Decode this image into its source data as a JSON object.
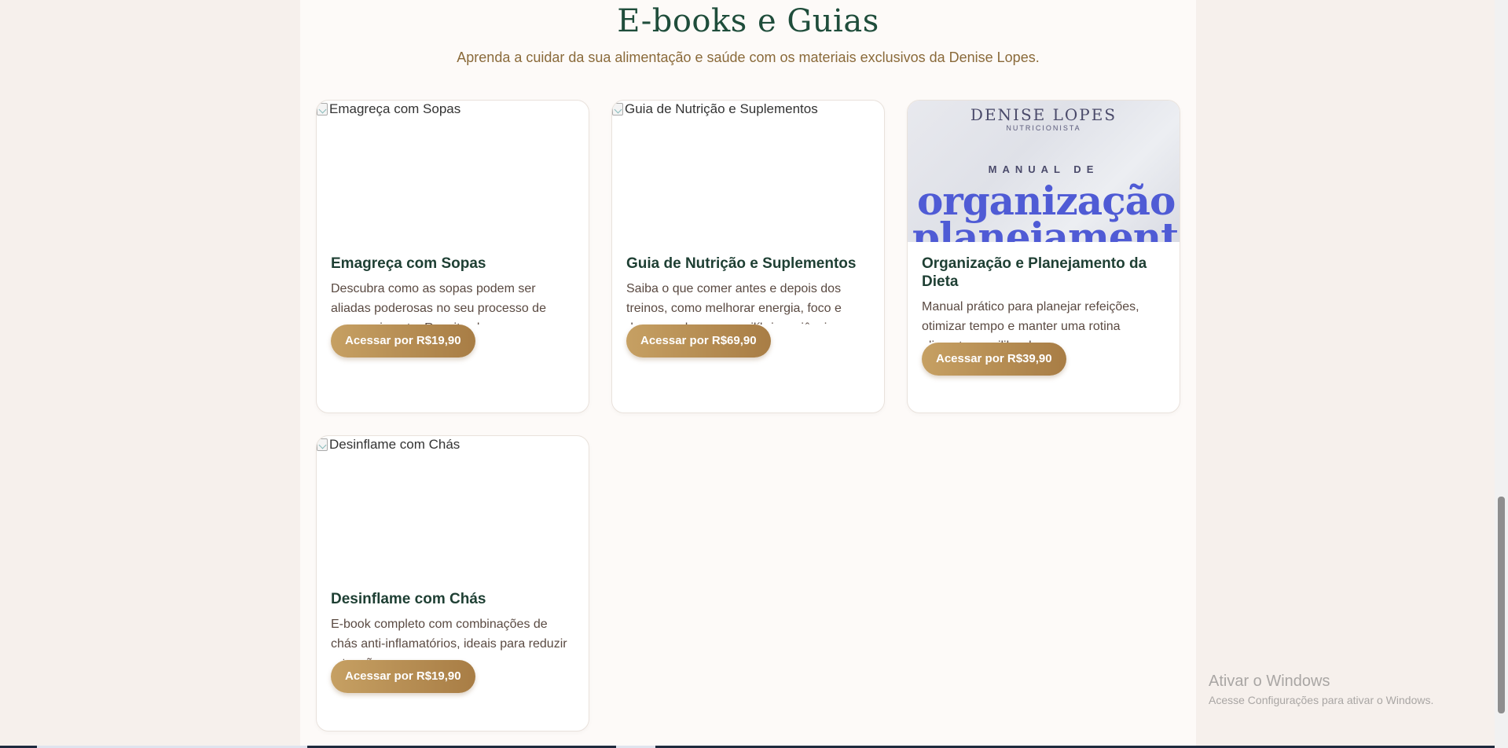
{
  "section": {
    "title": "E-books e Guias",
    "subtitle": "Aprenda a cuidar da sua alimentação e saúde com os materiais exclusivos da Denise Lopes."
  },
  "cards": [
    {
      "image_alt": "Emagreça com Sopas",
      "title": "Emagreça com Sopas",
      "description": "Descubra como as sopas podem ser aliadas poderosas no seu processo de emagrecimento. Receitas leves e",
      "button_label": "Acessar por R$19,90"
    },
    {
      "image_alt": "Guia de Nutrição e Suplementos",
      "title": "Guia de Nutrição e Suplementos",
      "description": "Saiba o que comer antes e depois dos treinos, como melhorar energia, foco e desempenho com equilíbrio e ciência.",
      "button_label": "Acessar por R$69,90"
    },
    {
      "title": "Organização e Planejamento da Dieta",
      "description": "Manual prático para planejar refeições, otimizar tempo e manter uma rotina alimentar equilibrada.",
      "button_label": "Acessar por R$39,90",
      "cover": {
        "brand": "DENISE LOPES",
        "role": "NUTRICIONISTA",
        "manual": "MANUAL DE",
        "line1": "organização",
        "amp": "&",
        "line2": "planejamento"
      }
    },
    {
      "image_alt": "Desinflame com Chás",
      "title": "Desinflame com Chás",
      "description": "E-book completo com combinações de chás anti-inflamatórios, ideais para reduzir retenção e promover",
      "button_label": "Acessar por R$19,90"
    }
  ],
  "watermark": {
    "title": "Ativar o Windows",
    "subtitle": "Acesse Configurações para ativar o Windows."
  },
  "colors": {
    "heading": "#1f4d3b",
    "subtitle": "#8a6a3a",
    "button": "#b88e52",
    "cover_text": "#4f5bd5",
    "background": "#f6f0ec"
  }
}
